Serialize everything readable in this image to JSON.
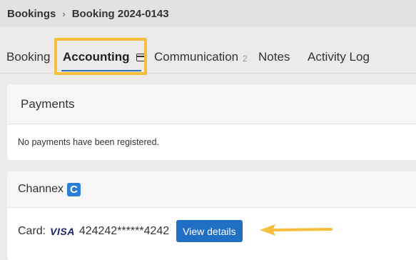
{
  "breadcrumb": {
    "root": "Bookings",
    "separator": "›",
    "current": "Booking 2024-0143"
  },
  "tabs": [
    {
      "label": "Booking"
    },
    {
      "label": "Accounting",
      "icon": "credit-card-icon"
    },
    {
      "label": "Communication",
      "count": "2"
    },
    {
      "label": "Notes"
    },
    {
      "label": "Activity Log"
    }
  ],
  "payments": {
    "title": "Payments",
    "empty_text": "No payments have been registered."
  },
  "channex": {
    "title": "Channex",
    "logo_letter": "C",
    "card_label": "Card:",
    "card_brand": "VISA",
    "card_number": "424242******4242",
    "view_details_label": "View details"
  },
  "colors": {
    "highlight": "#f6be3c",
    "accent": "#1f6fc5",
    "annotation_arrow": "#f6be3c"
  }
}
